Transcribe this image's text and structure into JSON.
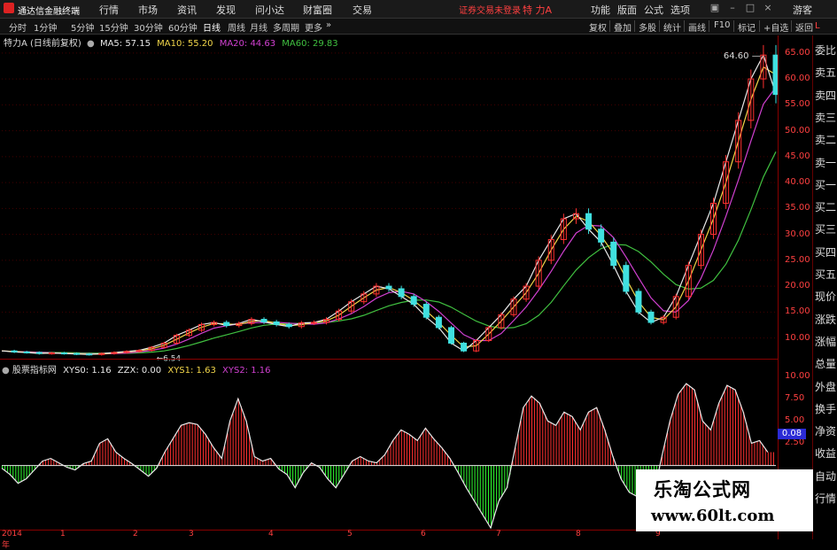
{
  "app": {
    "title": "通达信金融终端"
  },
  "menu": [
    "行情",
    "市场",
    "资讯",
    "发现",
    "问小达",
    "财富圈",
    "交易"
  ],
  "login_status": "证券交易未登录",
  "stock_name": "特 力A",
  "right_menu": [
    "功能",
    "版面",
    "公式",
    "选项"
  ],
  "user": "游客",
  "periods": [
    "分时",
    "1分钟",
    "5分钟",
    "15分钟",
    "30分钟",
    "60分钟",
    "日线",
    "周线",
    "月线",
    "多周期",
    "更多"
  ],
  "active_period": "日线",
  "tools": [
    "复权",
    "叠加",
    "多股",
    "统计",
    "画线",
    "F10",
    "标记",
    "+自选",
    "返回"
  ],
  "main_info": {
    "name": "特力A (日线前复权)",
    "ma5": "MA5: 57.15",
    "ma10": "MA10: 55.20",
    "ma20": "MA20: 44.63",
    "ma60": "MA60: 29.83"
  },
  "high_label": "64.60",
  "low_label": "6.54",
  "right_panel": [
    "委比",
    "卖五",
    "卖四",
    "卖三",
    "卖二",
    "卖一",
    "买一",
    "买二",
    "买三",
    "买四",
    "买五",
    "现价",
    "涨跌",
    "涨幅",
    "总量",
    "外盘",
    "换手",
    "净资",
    "收益",
    "自动",
    "行情"
  ],
  "indicator_info": {
    "name": "股票指标网",
    "xys0": "XYS0: 1.16",
    "zzx": "ZZX: 0.00",
    "xys1": "XYS1: 1.63",
    "xys2": "XYS2: 1.16"
  },
  "current_value": "0.08",
  "year_label": "2014年",
  "watermark": {
    "line1": "乐淘公式网",
    "line2": "www.60lt.com"
  },
  "chart_data": [
    {
      "type": "line",
      "title": "特力A (日线前复权)",
      "y_ticks": [
        10,
        15,
        20,
        25,
        30,
        35,
        40,
        45,
        50,
        55,
        60,
        65
      ],
      "ylim": [
        6,
        66
      ],
      "x_tick_labels": [
        "2014年",
        "1",
        "2",
        "3",
        "4",
        "5",
        "6",
        "7",
        "8",
        "9"
      ],
      "close_series": [
        7.5,
        7.3,
        7.2,
        7.0,
        7.1,
        7.0,
        6.9,
        6.8,
        7.0,
        7.2,
        7.4,
        7.6,
        8.2,
        9.0,
        10.5,
        11.5,
        12.6,
        13.0,
        12.4,
        12.8,
        13.6,
        13.1,
        12.6,
        12.2,
        12.9,
        13.0,
        13.6,
        15.2,
        17.0,
        18.5,
        20.0,
        19.5,
        18.0,
        16.5,
        14.0,
        12.0,
        9.0,
        7.5,
        9.5,
        12.0,
        14.5,
        17.5,
        20.0,
        25.0,
        29.0,
        33.0,
        34.0,
        31.0,
        28.5,
        24.0,
        19.0,
        15.0,
        13.0,
        14.0,
        18.0,
        24.0,
        30.0,
        36.0,
        44.0,
        52.0,
        60.0,
        64.6,
        57.0
      ],
      "ma_colors": {
        "ma5": "#e8e8e8",
        "ma10": "#f2d64a",
        "ma20": "#d040d0",
        "ma60": "#40c040"
      }
    },
    {
      "type": "bar",
      "title": "股票指标网",
      "y_ticks": [
        2.5,
        5.0,
        7.5,
        10.0
      ],
      "ylim": [
        -7,
        10.5
      ],
      "values": [
        -0.3,
        -1.0,
        -2.0,
        -1.5,
        -0.5,
        0.5,
        0.8,
        0.3,
        -0.2,
        -0.5,
        0.2,
        0.5,
        2.5,
        3.0,
        1.5,
        0.8,
        0.2,
        -0.5,
        -1.2,
        -0.3,
        1.5,
        3.0,
        4.5,
        4.8,
        4.6,
        3.5,
        2.0,
        0.8,
        5.0,
        7.5,
        5.0,
        1.0,
        0.5,
        0.8,
        -0.4,
        -1.0,
        -2.5,
        -0.8,
        0.3,
        -0.2,
        -1.5,
        -2.5,
        -1.0,
        0.5,
        1.0,
        0.5,
        0.3,
        1.2,
        2.8,
        4.0,
        3.5,
        2.8,
        4.2,
        3.0,
        2.0,
        0.8,
        -0.8,
        -2.5,
        -4.0,
        -5.5,
        -7.0,
        -4.0,
        -2.5,
        2.0,
        6.5,
        7.8,
        7.0,
        5.0,
        4.5,
        6.0,
        5.5,
        4.0,
        6.0,
        6.5,
        4.0,
        1.0,
        -1.5,
        -3.0,
        -3.5,
        -3.5,
        -3.2,
        1.0,
        5.0,
        8.0,
        9.2,
        8.5,
        5.0,
        4.0,
        7.0,
        9.0,
        8.5,
        6.0,
        2.5,
        2.8,
        1.5
      ],
      "pos_color": "#ff3030",
      "neg_color": "#30ff30"
    }
  ]
}
